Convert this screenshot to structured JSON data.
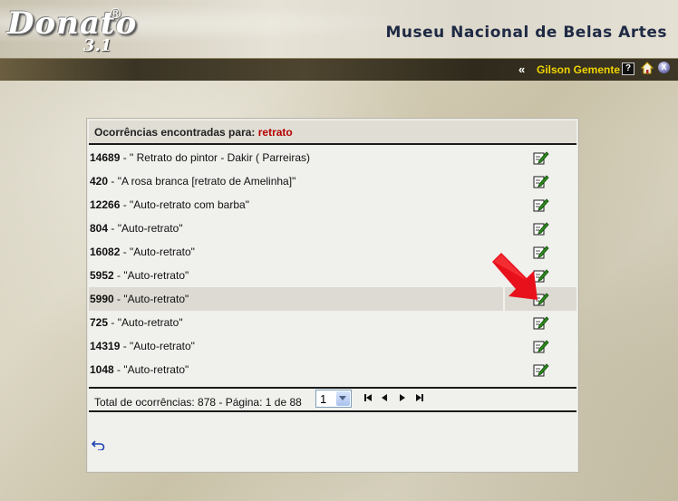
{
  "header": {
    "logo_text": "Donato",
    "logo_registered": "®",
    "logo_version": "3.1",
    "museum_name": "Museu Nacional de Belas Artes"
  },
  "userbar": {
    "guillemet": "«",
    "user_name": "Gilson Gemente",
    "help_label": "?",
    "exit_label": "X"
  },
  "results": {
    "header_label": "Ocorrências encontradas para: ",
    "search_term": "retrato",
    "items": [
      {
        "id": "14689",
        "title": " - \" Retrato do pintor - Dakir ( Parreiras)"
      },
      {
        "id": "420",
        "title": " - \"A rosa branca [retrato de Amelinha]\""
      },
      {
        "id": "12266",
        "title": " - \"Auto-retrato com barba\""
      },
      {
        "id": "804",
        "title": " - \"Auto-retrato\""
      },
      {
        "id": "16082",
        "title": " - \"Auto-retrato\""
      },
      {
        "id": "5952",
        "title": " - \"Auto-retrato\""
      },
      {
        "id": "5990",
        "title": " - \"Auto-retrato\""
      },
      {
        "id": "725",
        "title": " - \"Auto-retrato\""
      },
      {
        "id": "14319",
        "title": " - \"Auto-retrato\""
      },
      {
        "id": "1048",
        "title": " - \"Auto-retrato\""
      }
    ],
    "highlighted_index": 6
  },
  "pagination": {
    "total_text": "Total de ocorrências: 878 - Página: 1 de 88",
    "page_select_value": "1"
  },
  "colors": {
    "search_term": "#b40000",
    "user_name": "#f0d400",
    "pointer_arrow": "#e8101a",
    "edit_icon": "#2e8b1e"
  }
}
